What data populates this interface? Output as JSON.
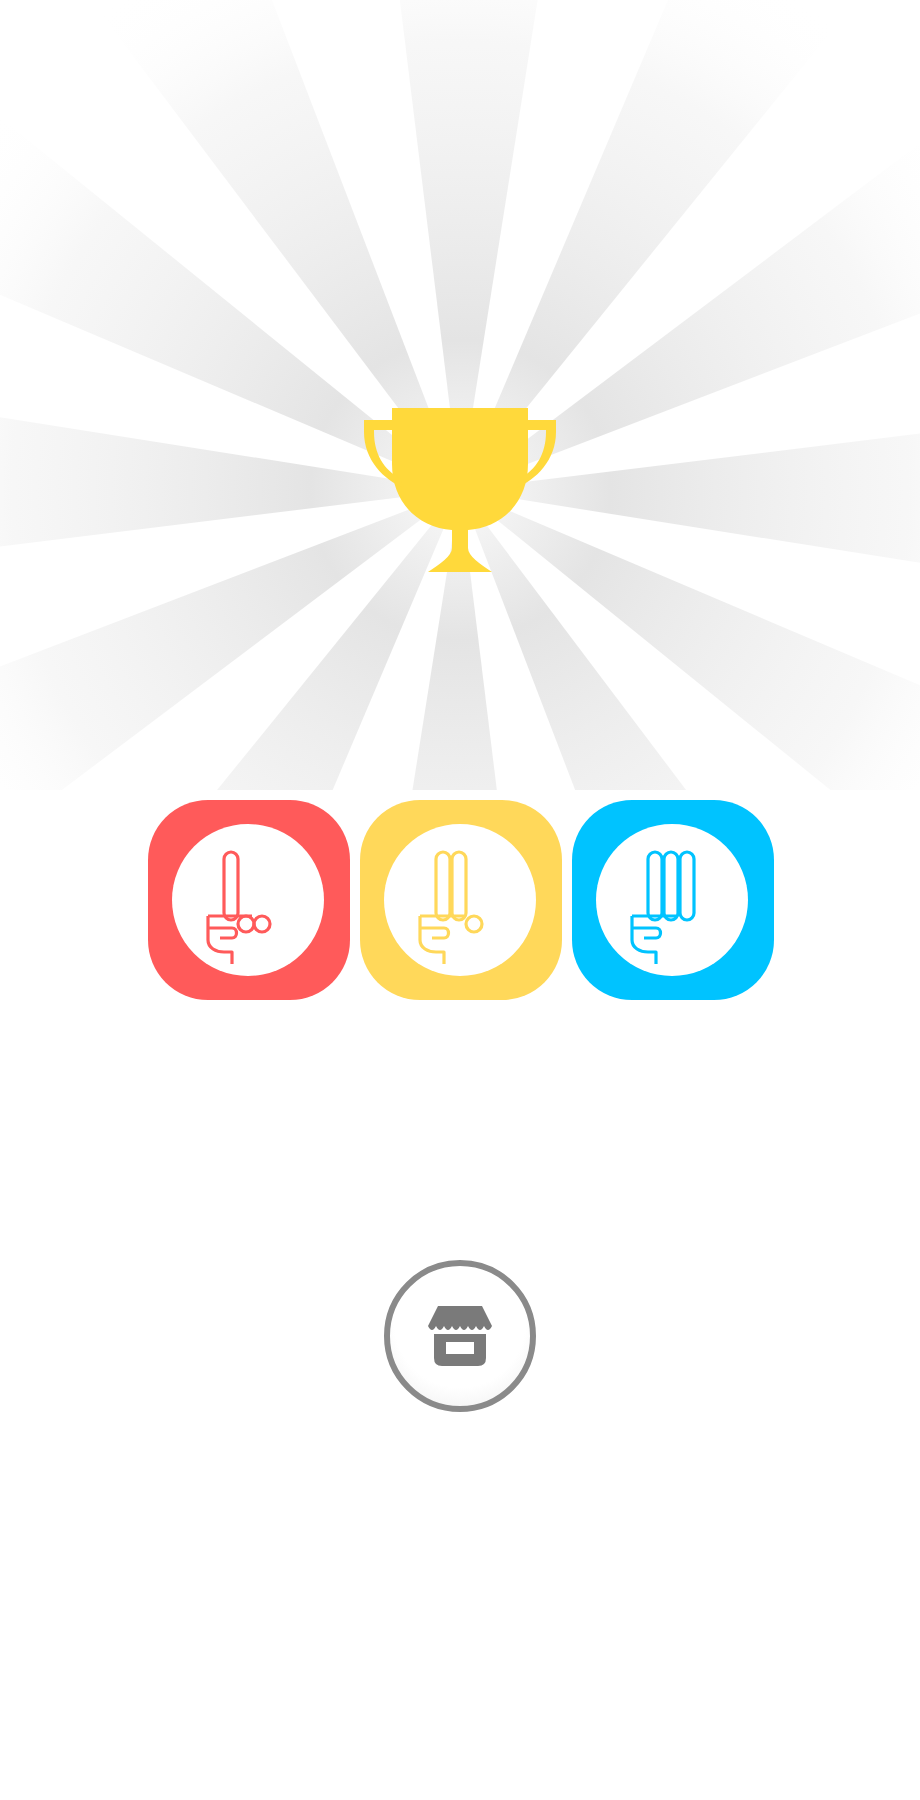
{
  "choices": [
    {
      "kind": "one",
      "color": "#ff5a5a"
    },
    {
      "kind": "two",
      "color": "#ffd85a"
    },
    {
      "kind": "three",
      "color": "#00c3ff"
    }
  ]
}
